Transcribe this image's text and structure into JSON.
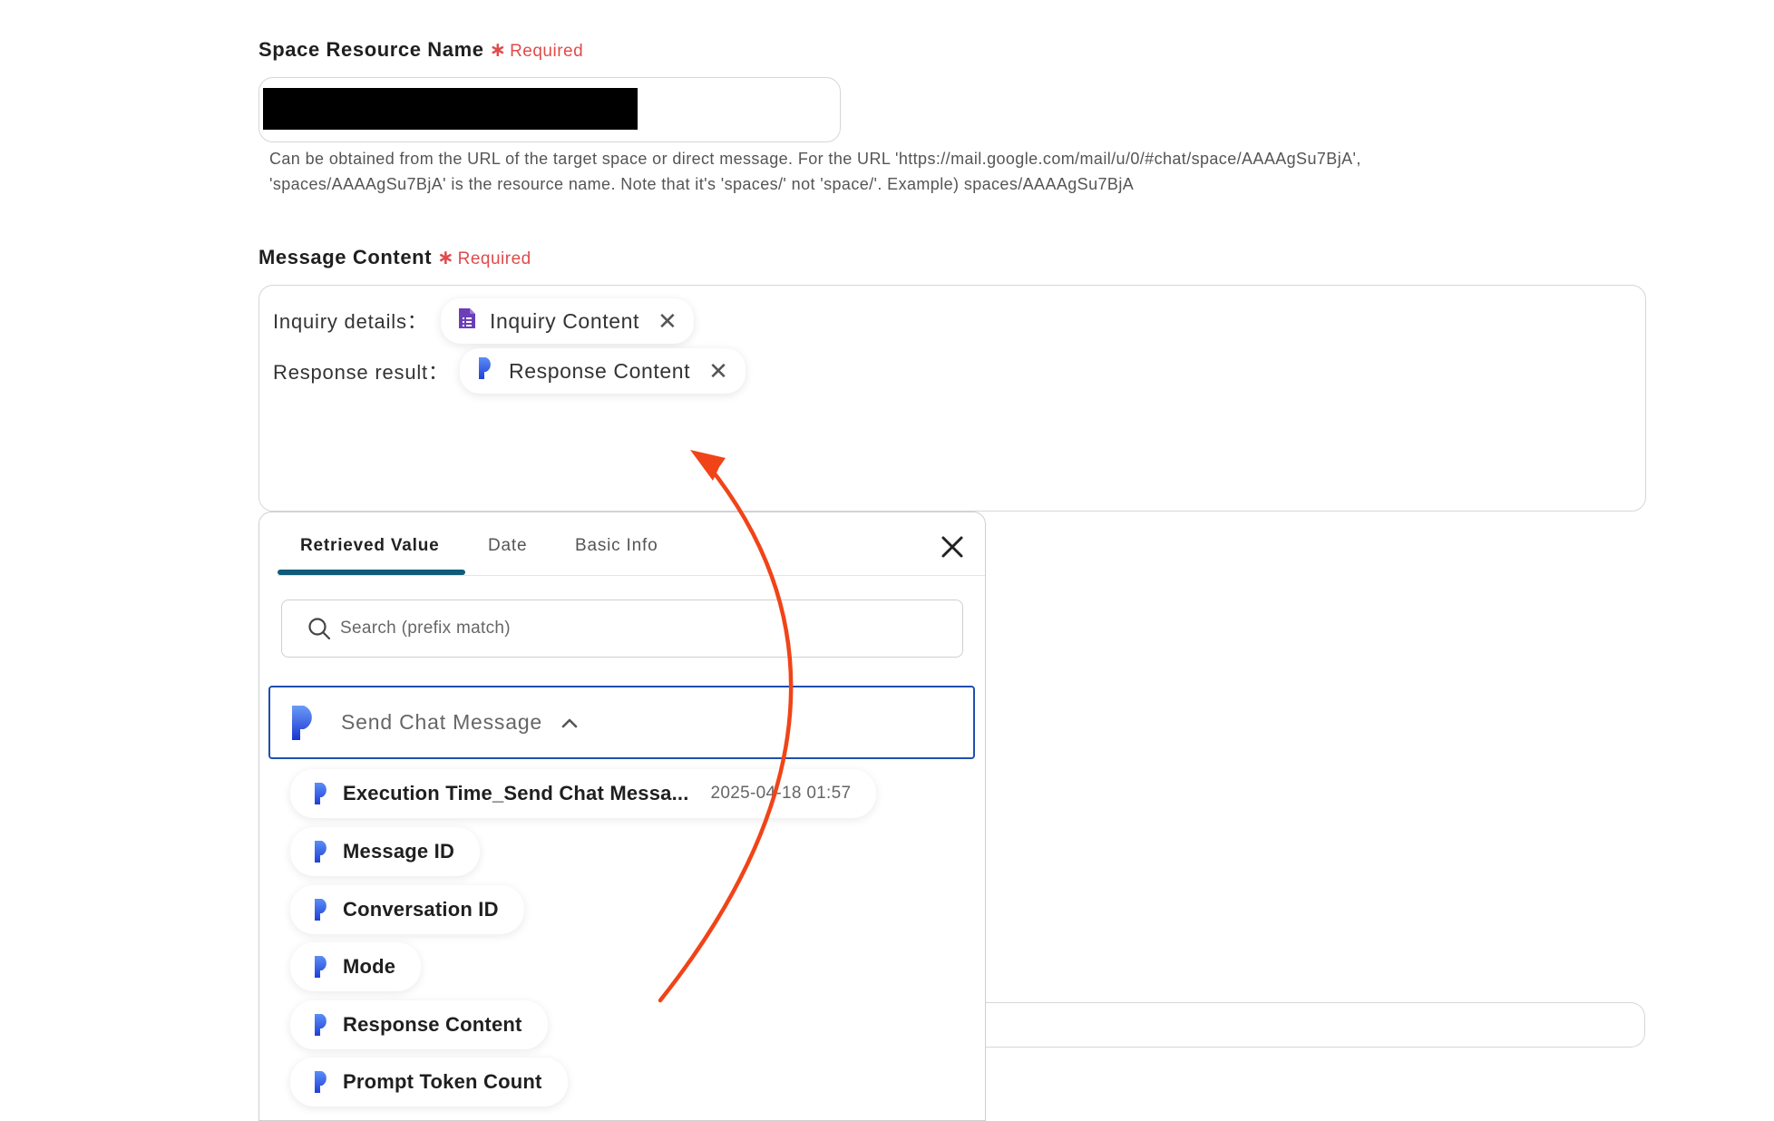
{
  "space_field": {
    "label": "Space Resource Name",
    "required_star": "∗",
    "required_text": "Required",
    "help_line1": "Can be obtained from the URL of the target space or direct message. For the URL 'https://mail.google.com/mail/u/0/#chat/space/AAAAgSu7BjA',",
    "help_line2": "'spaces/AAAAgSu7BjA' is the resource name. Note that it's 'spaces/' not 'space/'. Example) spaces/AAAAgSu7BjA"
  },
  "message_field": {
    "label": "Message Content",
    "required_star": "∗",
    "required_text": "Required",
    "lines": [
      {
        "label": "Inquiry details：",
        "chip": "Inquiry Content",
        "icon": "google-forms-icon"
      },
      {
        "label": "Response result：",
        "chip": "Response Content",
        "icon": "dify-icon"
      }
    ]
  },
  "picker": {
    "tabs": [
      "Retrieved Value",
      "Date",
      "Basic Info"
    ],
    "active_tab": 0,
    "search_placeholder": "Search (prefix match)",
    "group_label": "Send Chat Message",
    "items": [
      {
        "label": "Execution Time_Send Chat Messa...",
        "value": "2025-04-18 01:57"
      },
      {
        "label": "Message ID",
        "value": ""
      },
      {
        "label": "Conversation ID",
        "value": ""
      },
      {
        "label": "Mode",
        "value": ""
      },
      {
        "label": "Response Content",
        "value": ""
      },
      {
        "label": "Prompt Token Count",
        "value": ""
      }
    ]
  },
  "colors": {
    "required": "#e14b4b",
    "tab_underline": "#0f5c7a",
    "group_border": "#1f4fb0",
    "arrow": "#f04418",
    "forms_purple": "#6b3fb8",
    "dify_blue": "#1f4fe0"
  }
}
